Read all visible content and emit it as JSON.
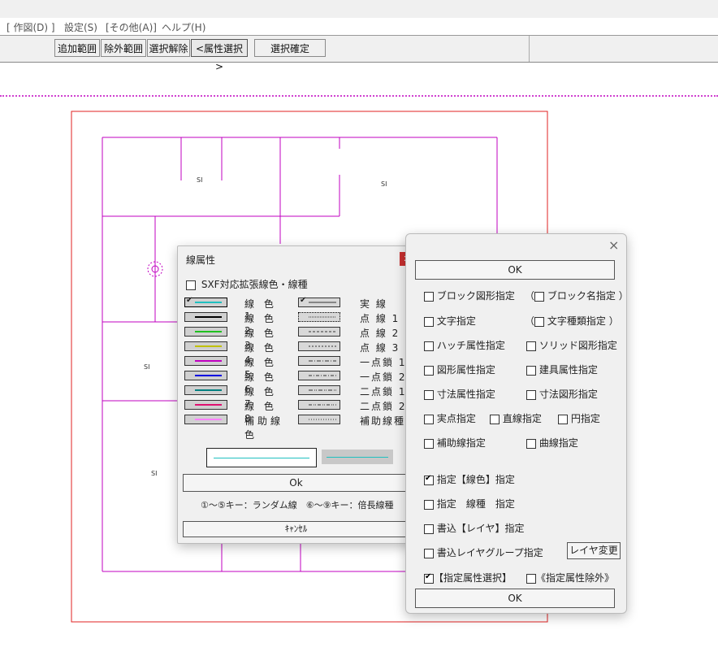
{
  "menu": [
    "[ 作図(D) ]",
    "設定(S)",
    "[その他(A)]",
    "ヘルプ(H)"
  ],
  "toolbar": {
    "add_range": "追加範囲",
    "exclude_range": "除外範囲",
    "clear_selection": "選択解除",
    "attr_select": "<属性選択>",
    "confirm_selection": "選択確定"
  },
  "drawing": {
    "labels": [
      "SI",
      "SI",
      "SI",
      "SI"
    ]
  },
  "line_dialog": {
    "title": "線属性",
    "close": "x",
    "sxf_label": "SXF対応拡張線色・線種",
    "colors": [
      {
        "label": "線 色 1",
        "color": "#20c0c0",
        "checked": true
      },
      {
        "label": "線 色 2",
        "color": "#000000",
        "checked": false
      },
      {
        "label": "線 色 3",
        "color": "#20c020",
        "checked": false
      },
      {
        "label": "線 色 4",
        "color": "#c0c000",
        "checked": false
      },
      {
        "label": "線 色 5",
        "color": "#c000c0",
        "checked": false
      },
      {
        "label": "線 色 6",
        "color": "#0000e0",
        "checked": false
      },
      {
        "label": "線 色 7",
        "color": "#008080",
        "checked": false
      },
      {
        "label": "線 色 8",
        "color": "#e01070",
        "checked": false
      },
      {
        "label": "補助線色",
        "color": "#ff80ff",
        "checked": false
      }
    ],
    "types": [
      {
        "label": "実 線",
        "checked": true
      },
      {
        "label": "点 線 1",
        "checked": false
      },
      {
        "label": "点 線 2",
        "checked": false
      },
      {
        "label": "点 線 3",
        "checked": false
      },
      {
        "label": "一点鎖 1",
        "checked": false
      },
      {
        "label": "一点鎖 2",
        "checked": false
      },
      {
        "label": "二点鎖 1",
        "checked": false
      },
      {
        "label": "二点鎖 2",
        "checked": false
      },
      {
        "label": "補助線種",
        "checked": false
      }
    ],
    "ok": "Ok",
    "hint": "①～⑤キー：ランダム線　⑥～⑨キー：倍長線種",
    "cancel": "ｷｬﾝｾﾙ"
  },
  "attr_dialog": {
    "close": "×",
    "ok_top": "OK",
    "block": "ブロック図形指定",
    "block_name": "ブロック名指定",
    "text": "文字指定",
    "text_type": "文字種類指定",
    "hatch": "ハッチ属性指定",
    "solid": "ソリッド図形指定",
    "shape_attr": "図形属性指定",
    "fixture_attr": "建具属性指定",
    "dim_attr": "寸法属性指定",
    "dim_shape": "寸法図形指定",
    "point": "実点指定",
    "straight": "直線指定",
    "circle": "円指定",
    "aux_line": "補助線指定",
    "curve": "曲線指定",
    "spec_color": "指定【線色】指定",
    "spec_type": "指定　線種　指定",
    "layer_write": "書込【レイヤ】指定",
    "layer_group": "書込レイヤグループ指定",
    "layer_change": "レイヤ変更",
    "attr_select": "【指定属性選択】",
    "attr_exclude": "《指定属性除外》",
    "ok_bottom": "OK",
    "paren_open": "（",
    "paren_close": "）"
  }
}
